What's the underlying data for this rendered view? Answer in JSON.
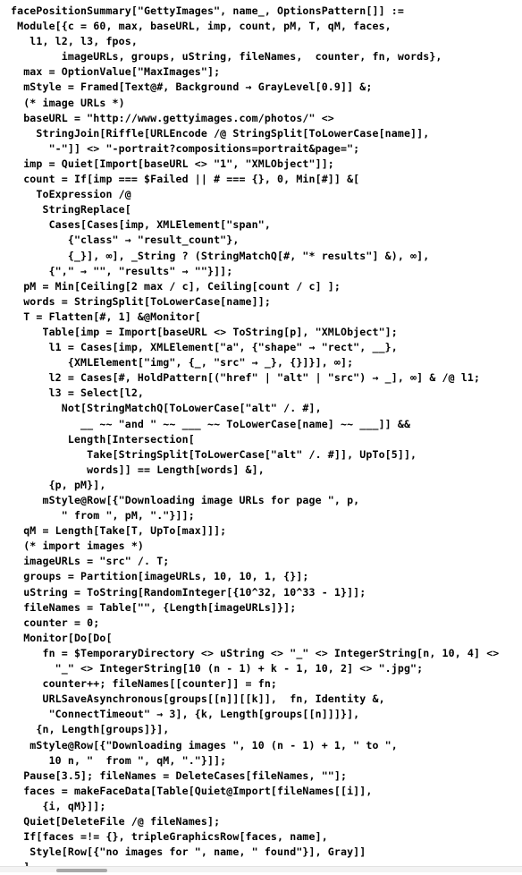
{
  "document": {
    "type": "wolfram-language-code-cell",
    "language": "Wolfram Language",
    "background_color": "#ffffff",
    "text_color": "#000000"
  },
  "code": {
    "lines": [
      "facePositionSummary[\"GettyImages\", name_, OptionsPattern[]] :=",
      " Module[{c = 60, max, baseURL, imp, count, pM, T, qM, faces,",
      "   l1, l2, l3, fpos,",
      "        imageURLs, groups, uString, fileNames,  counter, fn, words},",
      "  max = OptionValue[\"MaxImages\"];",
      "  mStyle = Framed[Text@#, Background → GrayLevel[0.9]] &;",
      "  (* image URLs *)",
      "  baseURL = \"http://www.gettyimages.com/photos/\" <>",
      "    StringJoin[Riffle[URLEncode /@ StringSplit[ToLowerCase[name]],",
      "      \"-\"]] <> \"-portrait?compositions=portrait&page=\";",
      "  imp = Quiet[Import[baseURL <> \"1\", \"XMLObject\"]];",
      "  count = If[imp === $Failed || # === {}, 0, Min[#]] &[",
      "    ToExpression /@",
      "     StringReplace[",
      "      Cases[Cases[imp, XMLElement[\"span\",",
      "         {\"class\" → \"result_count\"},",
      "         {_}], ∞], _String ? (StringMatchQ[#, \"* results\"] &), ∞],",
      "      {\",\" → \"\", \"results\" → \"\"}]];",
      "  pM = Min[Ceiling[2 max / c], Ceiling[count / c] ];",
      "  words = StringSplit[ToLowerCase[name]];",
      "  T = Flatten[#, 1] &@Monitor[",
      "     Table[imp = Import[baseURL <> ToString[p], \"XMLObject\"];",
      "      l1 = Cases[imp, XMLElement[\"a\", {\"shape\" → \"rect\", __},",
      "         {XMLElement[\"img\", {_, \"src\" → _}, {}]}], ∞];",
      "      l2 = Cases[#, HoldPattern[(\"href\" | \"alt\" | \"src\") → _], ∞] & /@ l1;",
      "      l3 = Select[l2,",
      "        Not[StringMatchQ[ToLowerCase[\"alt\" /. #],",
      "           __ ~~ \"and \" ~~ ___ ~~ ToLowerCase[name] ~~ ___]] &&",
      "         Length[Intersection[",
      "            Take[StringSplit[ToLowerCase[\"alt\" /. #]], UpTo[5]],",
      "            words]] == Length[words] &],",
      "      {p, pM}],",
      "     mStyle@Row[{\"Downloading image URLs for page \", p,",
      "        \" from \", pM, \".\"}]];",
      "  qM = Length[Take[T, UpTo[max]]];",
      "  (* import images *)",
      "  imageURLs = \"src\" /. T;",
      "  groups = Partition[imageURLs, 10, 10, 1, {}];",
      "  uString = ToString[RandomInteger[{10^32, 10^33 - 1}]];",
      "  fileNames = Table[\"\", {Length[imageURLs]}];",
      "  counter = 0;",
      "  Monitor[Do[Do[",
      "     fn = $TemporaryDirectory <> uString <> \"_\" <> IntegerString[n, 10, 4] <>",
      "       \"_\" <> IntegerString[10 (n - 1) + k - 1, 10, 2] <> \".jpg\";",
      "     counter++; fileNames[[counter]] = fn;",
      "     URLSaveAsynchronous[groups[[n]][[k]],  fn, Identity &,",
      "      \"ConnectTimeout\" → 3], {k, Length[groups[[n]]]}],",
      "    {n, Length[groups]}],",
      "   mStyle@Row[{\"Downloading images \", 10 (n - 1) + 1, \" to \",",
      "      10 n, \"  from \", qM, \".\"}]];",
      "  Pause[3.5]; fileNames = DeleteCases[fileNames, \"\"];",
      "  faces = makeFaceData[Table[Quiet@Import[fileNames[[i]],",
      "     {i, qM}]];",
      "  Quiet[DeleteFile /@ fileNames];",
      "  If[faces =!= {}, tripleGraphicsRow[faces, name],",
      "   Style[Row[{\"no images for \", name, \" found\"}], Gray]]",
      "  ]"
    ]
  },
  "scrollbar": {
    "orientation": "horizontal",
    "thumb_color": "#a8a8a8",
    "track_color": "#f3f3f3"
  }
}
